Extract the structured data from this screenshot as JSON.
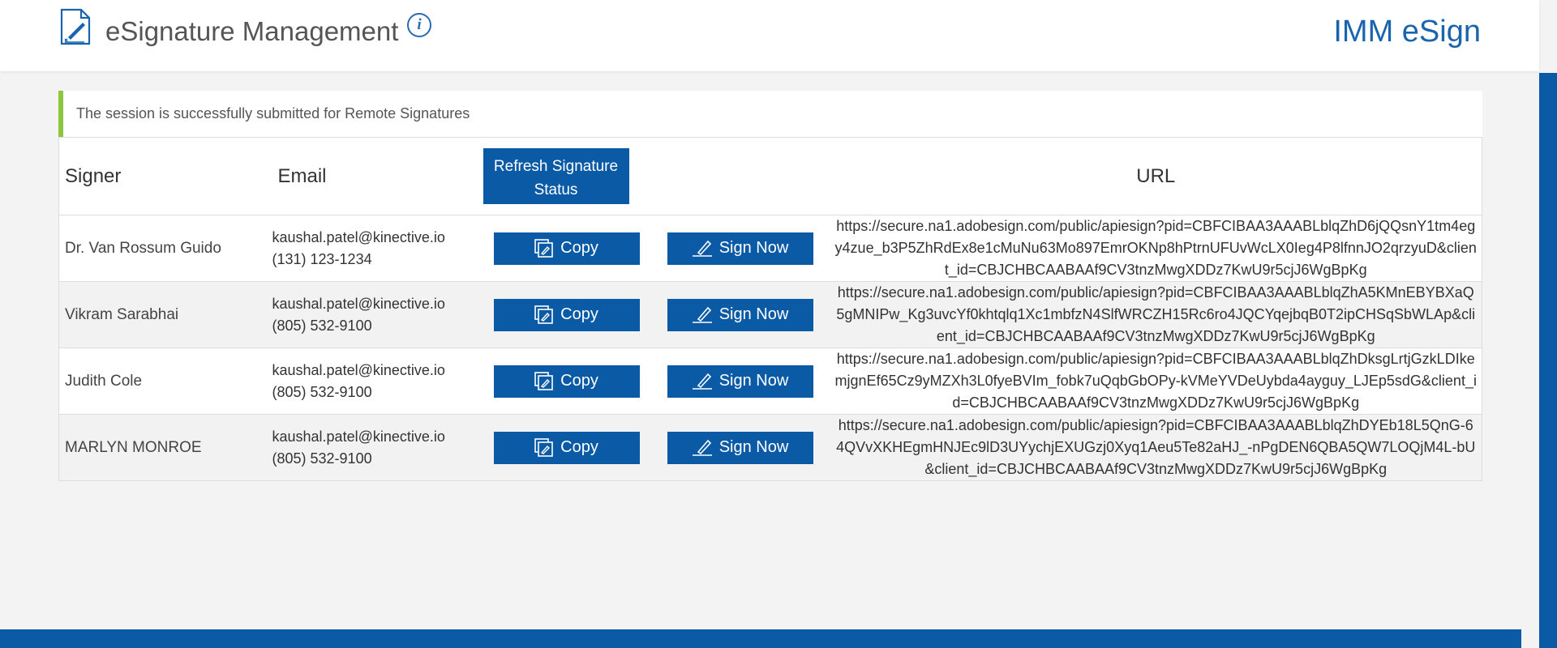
{
  "header": {
    "title": "eSignature Management",
    "info_icon": "i",
    "brand": "IMM eSign"
  },
  "alert": {
    "message": "The session is successfully submitted for Remote Signatures"
  },
  "table": {
    "columns": {
      "signer": "Signer",
      "email": "Email",
      "refresh_button": "Refresh Signature Status",
      "url": "URL"
    },
    "copy_label": "Copy",
    "sign_label": "Sign Now",
    "rows": [
      {
        "signer": "Dr. Van Rossum Guido",
        "email": "kaushal.patel@kinective.io",
        "phone": "(131) 123-1234",
        "url": "https://secure.na1.adobesign.com/public/apiesign?pid=CBFCIBAA3AAABLblqZhD6jQQsnY1tm4egy4zue_b3P5ZhRdEx8e1cMuNu63Mo897EmrOKNp8hPtrnUFUvWcLX0Ieg4P8lfnnJO2qrzyuD&client_id=CBJCHBCAABAAf9CV3tnzMwgXDDz7KwU9r5cjJ6WgBpKg"
      },
      {
        "signer": "Vikram Sarabhai",
        "email": "kaushal.patel@kinective.io",
        "phone": "(805) 532-9100",
        "url": "https://secure.na1.adobesign.com/public/apiesign?pid=CBFCIBAA3AAABLblqZhA5KMnEBYBXaQ5gMNIPw_Kg3uvcYf0khtqlq1Xc1mbfzN4SlfWRCZH15Rc6ro4JQCYqejbqB0T2ipCHSqSbWLAp&client_id=CBJCHBCAABAAf9CV3tnzMwgXDDz7KwU9r5cjJ6WgBpKg"
      },
      {
        "signer": "Judith Cole",
        "email": "kaushal.patel@kinective.io",
        "phone": "(805) 532-9100",
        "url": "https://secure.na1.adobesign.com/public/apiesign?pid=CBFCIBAA3AAABLblqZhDksgLrtjGzkLDIkemjgnEf65Cz9yMZXh3L0fyeBVIm_fobk7uQqbGbOPy-kVMeYVDeUybda4ayguy_LJEp5sdG&client_id=CBJCHBCAABAAf9CV3tnzMwgXDDz7KwU9r5cjJ6WgBpKg"
      },
      {
        "signer": "MARLYN MONROE",
        "email": "kaushal.patel@kinective.io",
        "phone": "(805) 532-9100",
        "url": "https://secure.na1.adobesign.com/public/apiesign?pid=CBFCIBAA3AAABLblqZhDYEb18L5QnG-64QVvXKHEgmHNJEc9lD3UYychjEXUGzj0Xyq1Aeu5Te82aHJ_-nPgDEN6QBA5QW7LOQjM4L-bU&client_id=CBJCHBCAABAAf9CV3tnzMwgXDDz7KwU9r5cjJ6WgBpKg"
      }
    ]
  },
  "colors": {
    "primary": "#0a5aa6",
    "brand_text": "#1a64ae",
    "success_accent": "#8dc63f"
  },
  "icons": {
    "logo": "document-signature-icon",
    "info": "info-icon",
    "copy": "copy-icon",
    "sign": "pen-icon"
  }
}
